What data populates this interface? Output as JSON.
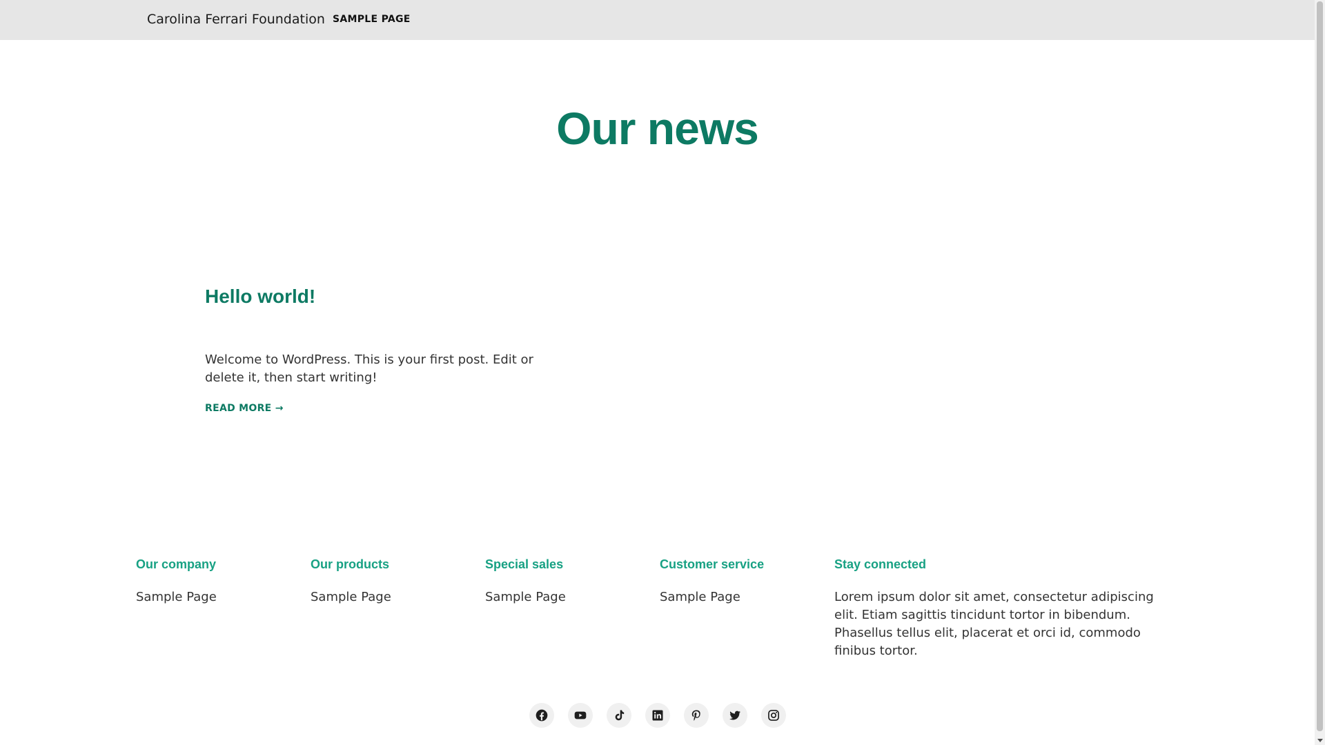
{
  "header": {
    "site_title": "Carolina Ferrari Foundation",
    "nav": [
      {
        "label": "SAMPLE PAGE"
      }
    ]
  },
  "main": {
    "heading": "Our news",
    "posts": [
      {
        "title": "Hello world!",
        "excerpt": "Welcome to WordPress. This is your first post. Edit or delete it, then start writing!",
        "read_more": "READ MORE →"
      }
    ]
  },
  "footer": {
    "columns": [
      {
        "title": "Our company",
        "link": "Sample Page"
      },
      {
        "title": "Our products",
        "link": "Sample Page"
      },
      {
        "title": "Special sales",
        "link": "Sample Page"
      },
      {
        "title": "Customer service",
        "link": "Sample Page"
      }
    ],
    "stay_connected": {
      "title": "Stay connected",
      "text": "Lorem ipsum dolor sit amet, consectetur adipiscing elit. Etiam sagittis tincidunt tortor in bibendum. Phasellus tellus elit, placerat et orci id, commodo finibus tortor."
    },
    "social": [
      "facebook-icon",
      "youtube-icon",
      "tiktok-icon",
      "linkedin-icon",
      "pinterest-icon",
      "twitter-icon",
      "instagram-icon"
    ]
  },
  "colors": {
    "accent": "#0d7a63",
    "footer_heading": "#17a183",
    "header_bg": "#e6e6e6",
    "text": "#333333"
  }
}
